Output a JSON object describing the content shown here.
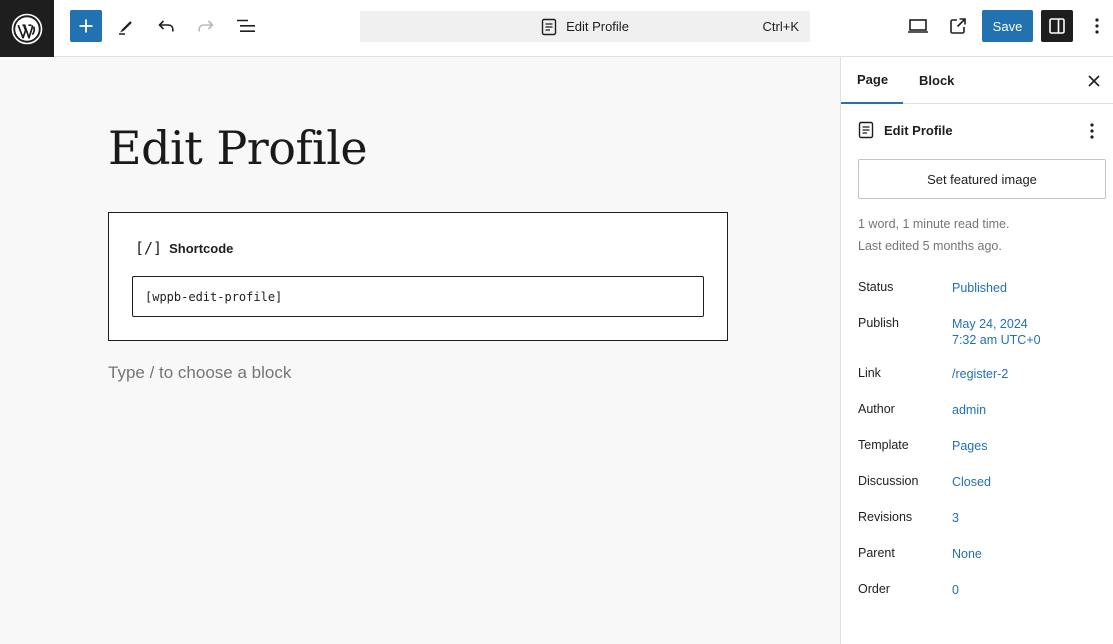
{
  "topbar": {
    "command_title": "Edit Profile",
    "command_shortcut": "Ctrl+K",
    "save_label": "Save"
  },
  "editor": {
    "page_title": "Edit Profile",
    "shortcode_block_label": "Shortcode",
    "shortcode_glyph": "[/]",
    "shortcode_value": "[wppb-edit-profile]",
    "block_placeholder": "Type / to choose a block"
  },
  "sidebar": {
    "tabs": [
      {
        "label": "Page"
      },
      {
        "label": "Block"
      }
    ],
    "document_title": "Edit Profile",
    "featured_image_label": "Set featured image",
    "word_count": "1 word, 1 minute read time.",
    "last_edited": "Last edited 5 months ago.",
    "properties": [
      {
        "label": "Status",
        "value": "Published"
      },
      {
        "label": "Publish",
        "value": "May 24, 2024",
        "value2": "7:32 am UTC+0"
      },
      {
        "label": "Link",
        "value": "/register-2"
      },
      {
        "label": "Author",
        "value": "admin"
      },
      {
        "label": "Template",
        "value": "Pages"
      },
      {
        "label": "Discussion",
        "value": "Closed"
      },
      {
        "label": "Revisions",
        "value": "3"
      },
      {
        "label": "Parent",
        "value": "None"
      },
      {
        "label": "Order",
        "value": "0"
      }
    ]
  },
  "colors": {
    "accent": "#2271b1",
    "dark": "#1e1e1e",
    "canvas_bg": "#f8f8f8",
    "muted_text": "#757575"
  },
  "icons": [
    "wordpress-logo-icon",
    "plus-icon",
    "pen-icon",
    "undo-icon",
    "redo-icon",
    "list-view-icon",
    "page-icon",
    "desktop-preview-icon",
    "external-link-icon",
    "sidebar-icon",
    "more-vertical-icon",
    "close-icon"
  ]
}
